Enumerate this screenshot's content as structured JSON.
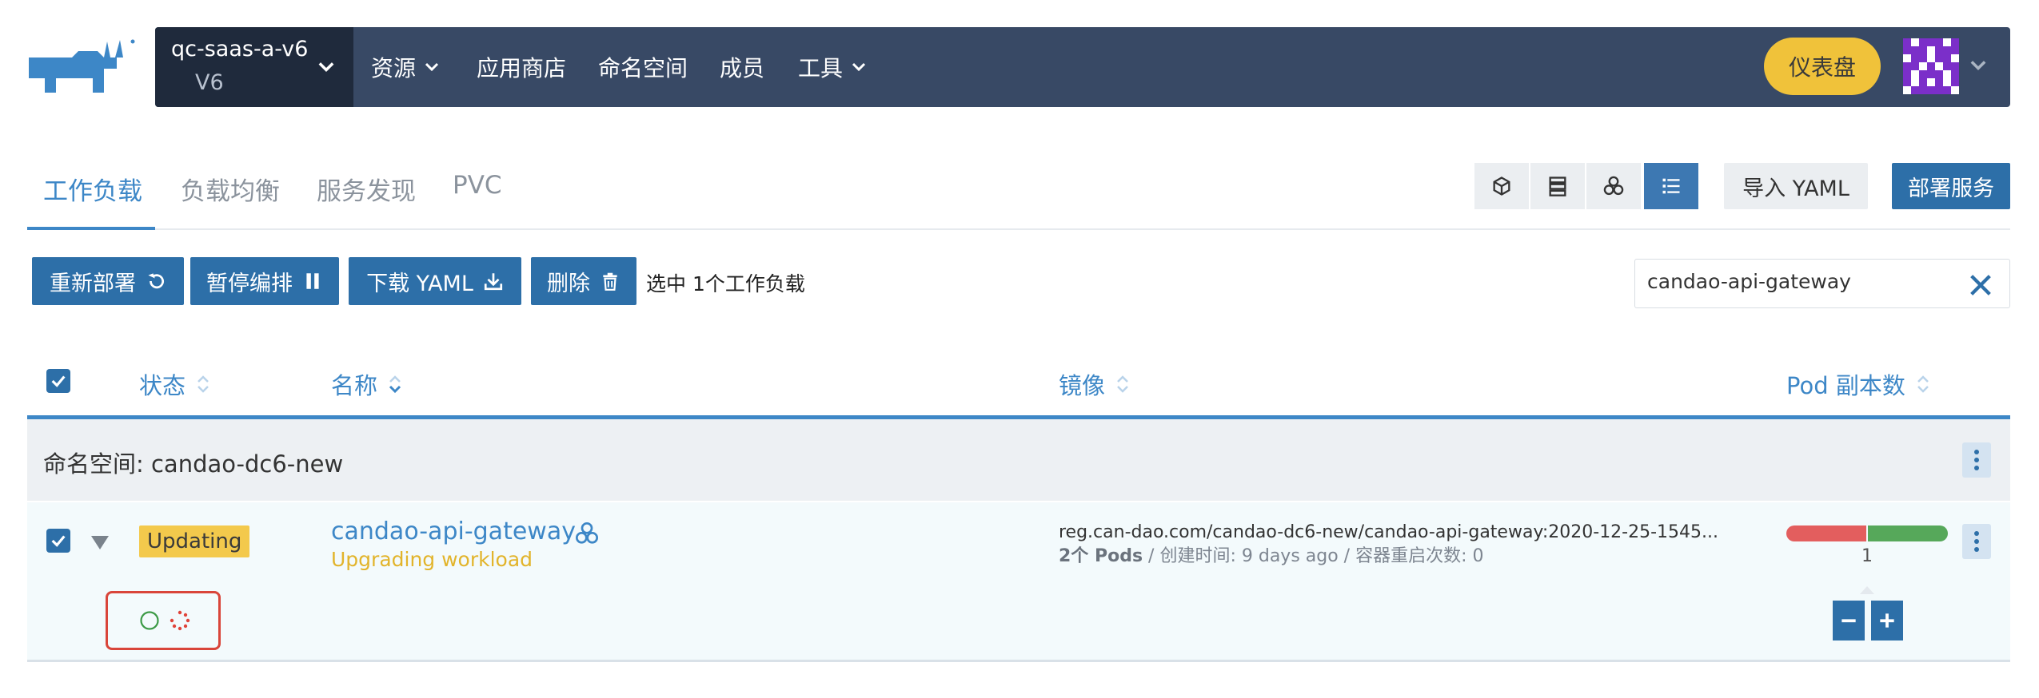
{
  "header": {
    "cluster_name": "qc-saas-a-v6",
    "cluster_version": "V6",
    "nav": [
      {
        "label": "资源",
        "has_dropdown": true
      },
      {
        "label": "应用商店",
        "has_dropdown": false
      },
      {
        "label": "命名空间",
        "has_dropdown": false
      },
      {
        "label": "成员",
        "has_dropdown": false
      },
      {
        "label": "工具",
        "has_dropdown": true
      }
    ],
    "dashboard_label": "仪表盘"
  },
  "tabs": [
    {
      "label": "工作负载",
      "active": true
    },
    {
      "label": "负载均衡",
      "active": false
    },
    {
      "label": "服务发现",
      "active": false
    },
    {
      "label": "PVC",
      "active": false
    }
  ],
  "view_buttons": [
    "cube-icon",
    "server-stack-icon",
    "node-cluster-icon",
    "list-view-icon"
  ],
  "toolbar": {
    "import_label": "导入 YAML",
    "deploy_label": "部署服务"
  },
  "actions": {
    "redeploy": "重新部署",
    "pause": "暂停编排",
    "download": "下载 YAML",
    "delete": "删除",
    "selection_text": "选中 1个工作负载"
  },
  "search": {
    "value": "candao-api-gateway"
  },
  "table": {
    "headers": {
      "status": "状态",
      "name": "名称",
      "image": "镜像",
      "pods": "Pod 副本数"
    }
  },
  "group": {
    "label": "命名空间: candao-dc6-new"
  },
  "workload": {
    "status": "Updating",
    "name": "candao-api-gateway",
    "sub_status": "Upgrading workload",
    "image": "reg.can-dao.com/candao-dc6-new/candao-api-gateway:2020-12-25-1545...",
    "pods_bold": "2个 Pods",
    "meta_rest": " / 创建时间: 9 days ago / 容器重启次数: 0",
    "pod_count": "1",
    "scale_split": {
      "red_fraction": 0.5,
      "green_fraction": 0.5
    }
  },
  "colors": {
    "navbar": "#384965",
    "accent": "#3d87c7",
    "primary_button": "#2d6fa8",
    "dashboard_button": "#f0c23a",
    "updating_badge": "#f3c94c",
    "highlight_box": "#d9453a"
  }
}
